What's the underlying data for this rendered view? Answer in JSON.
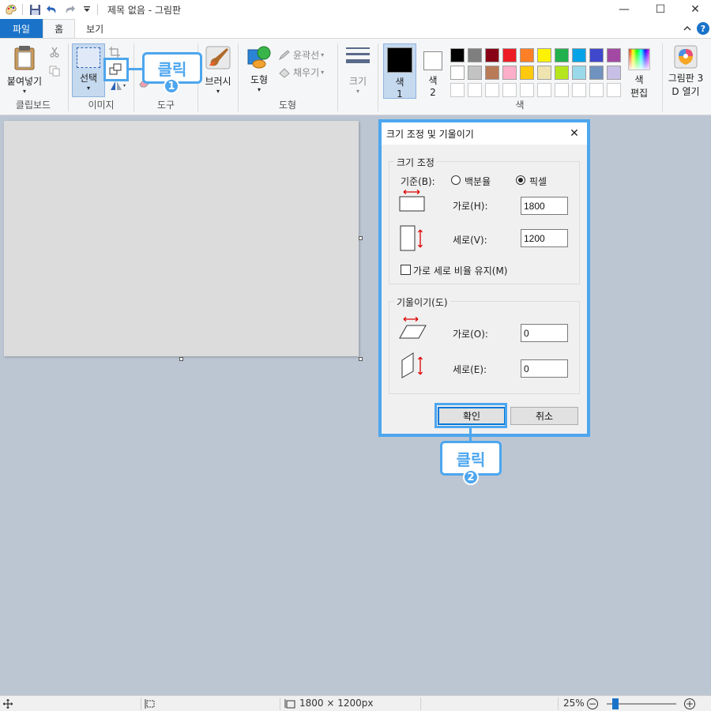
{
  "titlebar": {
    "title": "제목 없음 - 그림판",
    "minimize": "—",
    "maximize": "☐",
    "close": "✕"
  },
  "tabs": [
    {
      "label": "파일"
    },
    {
      "label": "홈"
    },
    {
      "label": "보기"
    }
  ],
  "help": {
    "label": "?"
  },
  "ribbon": {
    "clipboard": {
      "group_label": "클립보드",
      "paste_label": "붙여넣기"
    },
    "image": {
      "group_label": "이미지",
      "select_label": "선택"
    },
    "tools": {
      "group_label": "도구"
    },
    "brush": {
      "label": "브러시"
    },
    "shapes": {
      "group_label": "도형",
      "shapes_label": "도형",
      "outline_label": "윤곽선",
      "fill_label": "채우기"
    },
    "size": {
      "label": "크기"
    },
    "color1": {
      "label": "색\n1",
      "line1": "색",
      "line2": "1"
    },
    "color2": {
      "label": "색\n2",
      "line1": "색",
      "line2": "2"
    },
    "colors": {
      "group_label": "색"
    },
    "edit_colors": {
      "line1": "색",
      "line2": "편집"
    },
    "paint3d": {
      "line1": "그림판 3",
      "line2": "D 열기"
    }
  },
  "palette": {
    "row1": [
      "#000000",
      "#7f7f7f",
      "#880015",
      "#ed1c24",
      "#ff7f27",
      "#fff200",
      "#22b14c",
      "#00a2e8",
      "#3f48cc",
      "#a349a4"
    ],
    "row2": [
      "#ffffff",
      "#c3c3c3",
      "#b97a57",
      "#ffaec9",
      "#ffc90e",
      "#efe4b0",
      "#b5e61d",
      "#99d9ea",
      "#7092be",
      "#c8bfe7"
    ]
  },
  "dialog": {
    "title": "크기 조정 및 기울이기",
    "close": "✕",
    "resize": {
      "legend": "크기 조정",
      "basis_label": "기준(B):",
      "percent_label": "백분율",
      "pixel_label": "픽셀",
      "horizontal_label": "가로(H):",
      "horizontal_value": "1800",
      "vertical_label": "세로(V):",
      "vertical_value": "1200",
      "aspect_label": "가로 세로 비율 유지(M)"
    },
    "skew": {
      "legend": "기울이기(도)",
      "horizontal_label": "가로(O):",
      "horizontal_value": "0",
      "vertical_label": "세로(E):",
      "vertical_value": "0"
    },
    "ok_label": "확인",
    "cancel_label": "취소"
  },
  "callouts": [
    {
      "text": "클릭",
      "step": "1"
    },
    {
      "text": "클릭",
      "step": "2"
    }
  ],
  "statusbar": {
    "dimensions": "1800 × 1200px",
    "zoom": "25%"
  }
}
